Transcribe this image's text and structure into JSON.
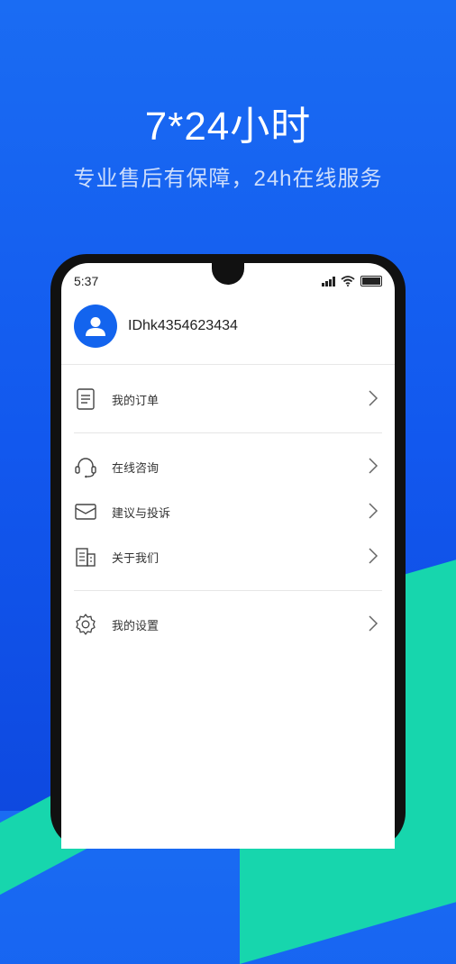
{
  "hero": {
    "title": "7*24小时",
    "subtitle": "专业售后有保障，24h在线服务"
  },
  "status_bar": {
    "time": "5:37"
  },
  "profile": {
    "user_id": "IDhk4354623434"
  },
  "menu": {
    "orders": "我的订单",
    "consult": "在线咨询",
    "feedback": "建议与投诉",
    "about": "关于我们",
    "settings": "我的设置"
  },
  "colors": {
    "primary": "#1364ee",
    "accent": "#17d6ad"
  },
  "icons": {
    "orders": "document-icon",
    "consult": "headset-icon",
    "feedback": "envelope-icon",
    "about": "building-icon",
    "settings": "gear-icon"
  }
}
